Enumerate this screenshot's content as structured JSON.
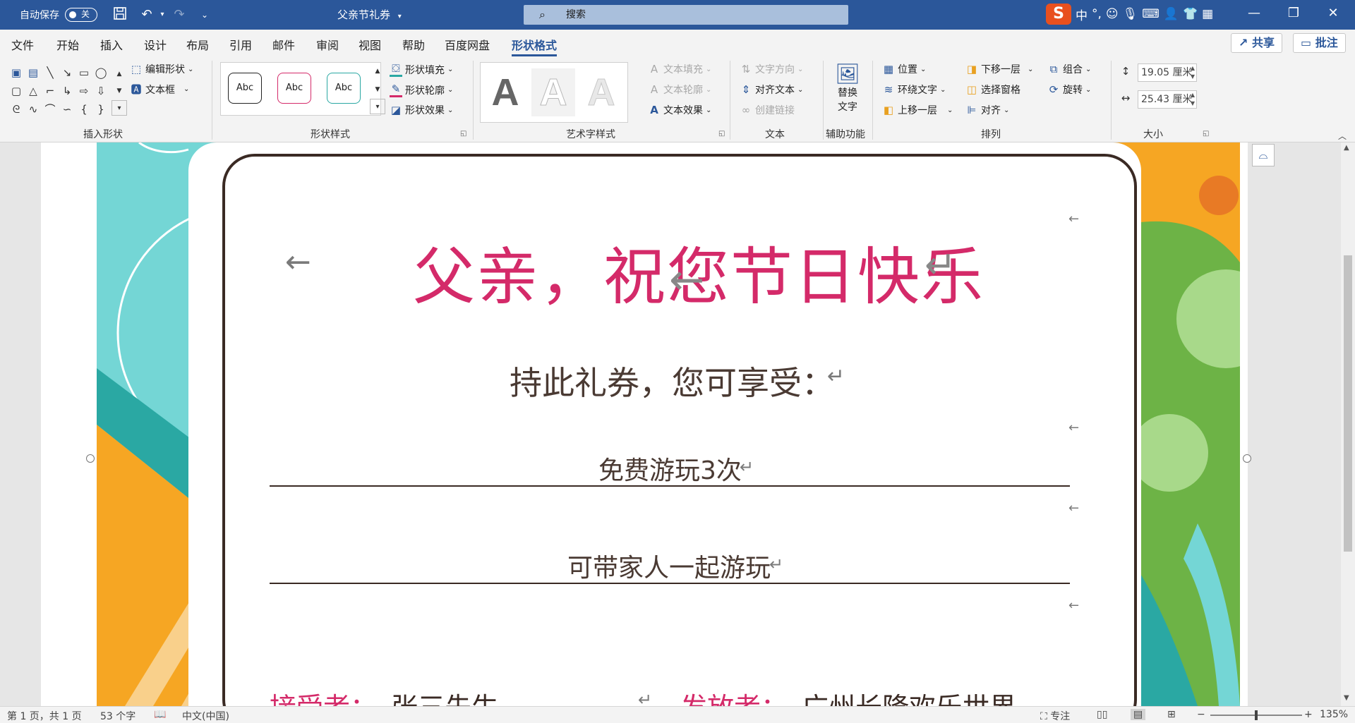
{
  "titlebar": {
    "autosave_label": "自动保存",
    "autosave_state": "关",
    "doc_title": "父亲节礼券",
    "search_placeholder": "搜索",
    "ime_mode": "中",
    "ime_punct": "°,"
  },
  "tabs": [
    "文件",
    "开始",
    "插入",
    "设计",
    "布局",
    "引用",
    "邮件",
    "审阅",
    "视图",
    "帮助",
    "百度网盘",
    "形状格式"
  ],
  "active_tab": "形状格式",
  "share_label": "共享",
  "comment_label": "批注",
  "ribbon": {
    "insert_shapes": {
      "group_label": "插入形状",
      "edit_shape": "编辑形状",
      "text_box": "文本框"
    },
    "shape_styles": {
      "group_label": "形状样式",
      "samples": [
        "Abc",
        "Abc",
        "Abc"
      ],
      "fill": "形状填充",
      "outline": "形状轮廓",
      "effects": "形状效果"
    },
    "wordart_styles": {
      "group_label": "艺术字样式",
      "samples": [
        "A",
        "A",
        "A"
      ],
      "text_fill": "文本填充",
      "text_outline": "文本轮廓",
      "text_effects": "文本效果"
    },
    "text": {
      "group_label": "文本",
      "direction": "文字方向",
      "align_text": "对齐文本",
      "create_link": "创建链接"
    },
    "accessibility": {
      "group_label": "辅助功能",
      "alt_text_1": "替换",
      "alt_text_2": "文字"
    },
    "arrange": {
      "group_label": "排列",
      "position": "位置",
      "wrap_text": "环绕文字",
      "bring_forward": "上移一层",
      "send_backward": "下移一层",
      "selection_pane": "选择窗格",
      "align": "对齐",
      "group": "组合",
      "rotate": "旋转"
    },
    "size": {
      "group_label": "大小",
      "height": "19.05 厘米",
      "width": "25.43 厘米"
    }
  },
  "document": {
    "title": "父亲，祝您节日快乐",
    "subtitle": "持此礼券，您可享受：",
    "item1": "免费游玩3次",
    "item2": "可带家人一起游玩",
    "receiver_label": "接受者：",
    "receiver_name": "张三先生",
    "issuer_label": "发放者：",
    "issuer_name": "广州长隆欢乐世界",
    "colors": {
      "title": "#d42a69",
      "body": "#4a3a33",
      "teal": "#74d6d5",
      "green": "#6db346",
      "orange": "#f6a623"
    }
  },
  "statusbar": {
    "page": "第 1 页，共 1 页",
    "words": "53 个字",
    "language": "中文(中国)",
    "focus": "专注",
    "zoom": "135%"
  }
}
